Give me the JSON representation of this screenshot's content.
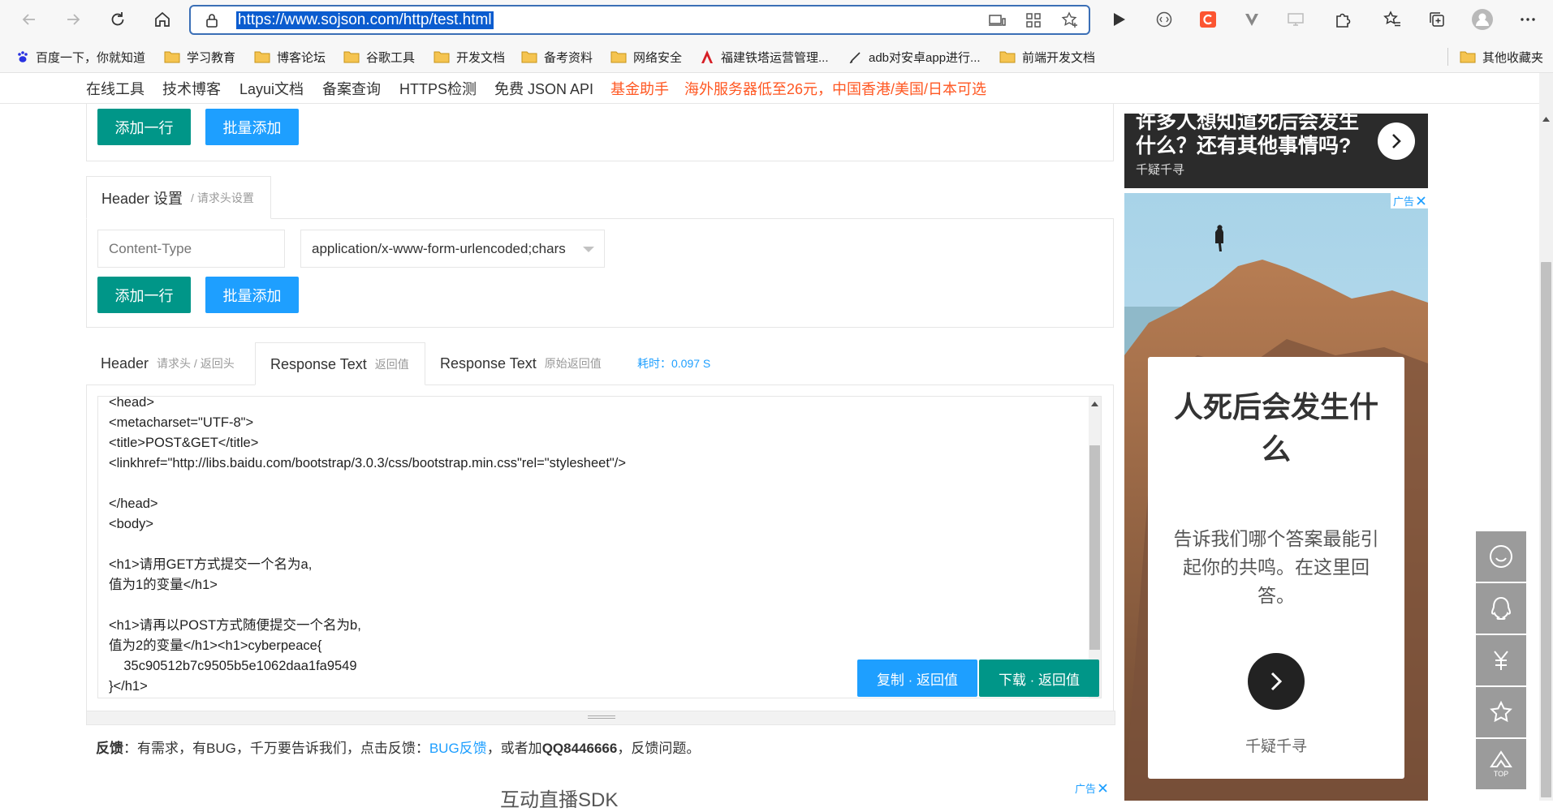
{
  "browser": {
    "url": "https://www.sojson.com/http/test.html",
    "bookmarks": [
      "百度一下，你就知道",
      "学习教育",
      "博客论坛",
      "谷歌工具",
      "开发文档",
      "备考资料",
      "网络安全",
      "福建铁塔运营管理...",
      "adb对安卓app进行...",
      "前端开发文档",
      "其他收藏夹"
    ]
  },
  "nav": {
    "items": [
      "在线工具",
      "技术博客",
      "Layui文档",
      "备案查询",
      "HTTPS检测",
      "免费 JSON API"
    ],
    "promo1": "基金助手",
    "promo2": "海外服务器低至26元，中国香港/美国/日本可选"
  },
  "params": {
    "add_row": "添加一行",
    "batch_add": "批量添加"
  },
  "header_panel": {
    "title": "Header 设置",
    "subtitle": "/ 请求头设置",
    "key_placeholder": "Content-Type",
    "value": "application/x-www-form-urlencoded;chars",
    "add_row": "添加一行",
    "batch_add": "批量添加"
  },
  "response_tabs": {
    "tab1": {
      "label": "Header",
      "sub": "请求头 / 返回头"
    },
    "tab2": {
      "label": "Response Text",
      "sub": "返回值"
    },
    "tab3": {
      "label": "Response Text",
      "sub": "原始返回值"
    },
    "timing": "耗时：0.097 S"
  },
  "response": {
    "lines": [
      "<head>",
      "<metacharset=\"UTF-8\">",
      "<title>POST&GET</title>",
      "<linkhref=\"http://libs.baidu.com/bootstrap/3.0.3/css/bootstrap.min.css\"rel=\"stylesheet\"/>",
      "",
      "</head>",
      "<body>",
      "",
      "<h1>请用GET方式提交一个名为a,",
      "值为1的变量</h1>",
      "",
      "<h1>请再以POST方式随便提交一个名为b,",
      "值为2的变量</h1><h1>cyberpeace{",
      "    35c90512b7c9505b5e1062daa1fa9549",
      "}</h1>"
    ],
    "copy_btn": "复制 · 返回值",
    "download_btn": "下载 · 返回值"
  },
  "feedback": {
    "label": "反馈",
    "text1": "：有需求，有BUG，千万要告诉我们，点击反馈：",
    "link": "BUG反馈",
    "text2": "，或者加",
    "qq": "QQ8446666",
    "text3": "，反馈问题。"
  },
  "bottom_ad": {
    "text": "互动直播SDK",
    "tag": "广告"
  },
  "ad_top": {
    "line1": "许多人想知道死后会发生",
    "line2": "什么？还有其他事情吗?",
    "brand": "千疑千寻"
  },
  "ad_main": {
    "tag": "广告",
    "title": "人死后会发生什么",
    "body": "告诉我们哪个答案最能引起你的共鸣。在这里回答。",
    "brand": "千疑千寻"
  },
  "float_tools": [
    "smile-icon",
    "qq-icon",
    "yen-icon",
    "star-icon",
    "top-icon"
  ],
  "float_top_label": "TOP",
  "colors": {
    "teal": "#009688",
    "blue": "#1e9fff",
    "orange": "#ff5722"
  }
}
